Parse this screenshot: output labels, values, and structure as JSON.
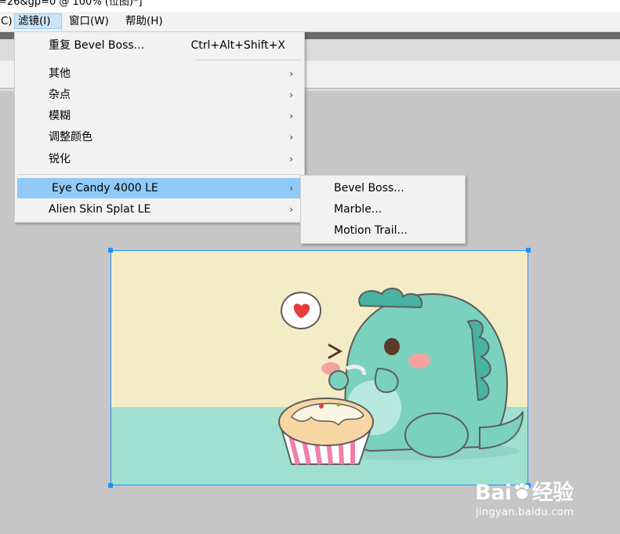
{
  "window": {
    "title": "=26&gp=0 @ 100% (位图)*]"
  },
  "menubar": {
    "items": [
      {
        "label": "C)"
      },
      {
        "label": "滤镜(I)"
      },
      {
        "label": "窗口(W)"
      },
      {
        "label": "帮助(H)"
      }
    ]
  },
  "filter_menu": {
    "repeat": {
      "label": "重复 Bevel Boss...",
      "shortcut": "Ctrl+Alt+Shift+X"
    },
    "items": [
      {
        "label": "其他"
      },
      {
        "label": "杂点"
      },
      {
        "label": "模糊"
      },
      {
        "label": "调整颜色"
      },
      {
        "label": "锐化"
      },
      {
        "label": "Eye Candy 4000 LE"
      },
      {
        "label": "Alien Skin Splat LE"
      }
    ],
    "arrow_glyph": "›"
  },
  "submenu": {
    "items": [
      {
        "label": "Bevel Boss..."
      },
      {
        "label": "Marble..."
      },
      {
        "label": "Motion Trail..."
      }
    ]
  },
  "watermark": {
    "brand_left": "Bai",
    "brand_right": "经验",
    "url": "jingyan.baidu.com"
  },
  "colors": {
    "highlight": "#91c9f7",
    "active_menu": "#cce4f7",
    "selection": "#1e90ff",
    "canvas_bg": "#c6c6c6"
  }
}
